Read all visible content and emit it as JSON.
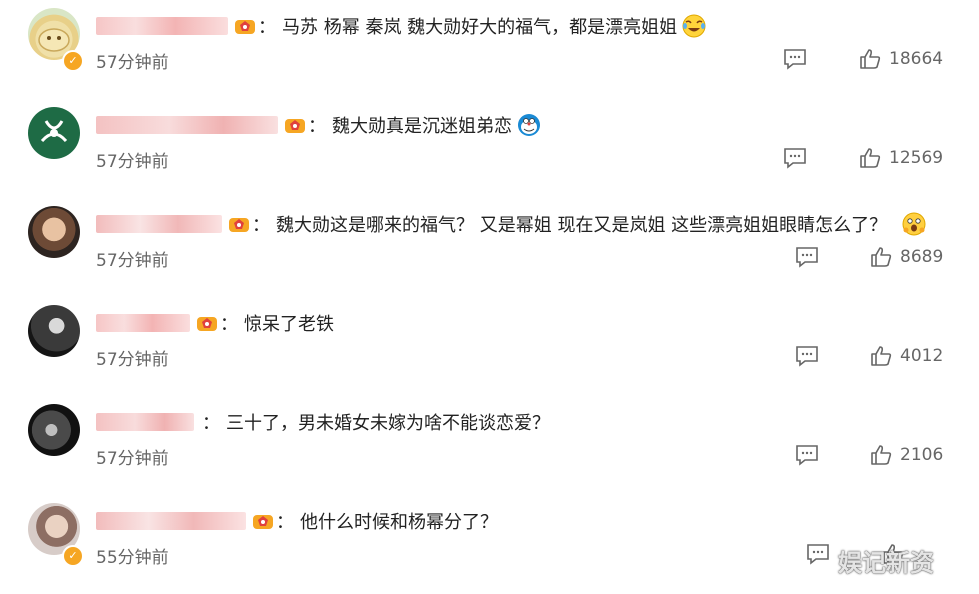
{
  "comments": [
    {
      "text": "马苏 杨幂 秦岚 魏大勋好大的福气，都是漂亮姐姐",
      "time": "57分钟前",
      "likes": "18664",
      "emoji": "crying-laughing-emoji"
    },
    {
      "text": "魏大勋真是沉迷姐弟恋",
      "time": "57分钟前",
      "likes": "12569",
      "emoji": "doraemon-emoji"
    },
    {
      "text": "魏大勋这是哪来的福气？ 又是幂姐 现在又是岚姐 这些漂亮姐姐眼睛怎么了？",
      "time": "57分钟前",
      "likes": "8689",
      "emoji": "shocked-emoji"
    },
    {
      "text": "惊呆了老铁",
      "time": "57分钟前",
      "likes": "4012"
    },
    {
      "text": "三十了，男未婚女未嫁为啥不能谈恋爱？",
      "time": "57分钟前",
      "likes": "2106"
    },
    {
      "text": "他什么时候和杨幂分了？",
      "time": "55分钟前",
      "likes": "",
      "like_label": "赞"
    }
  ],
  "watermark": "娱记新资",
  "colors": {
    "badge": "#f6a623",
    "text": "#222222",
    "meta": "#666666",
    "blur": "#f4c2c2"
  }
}
